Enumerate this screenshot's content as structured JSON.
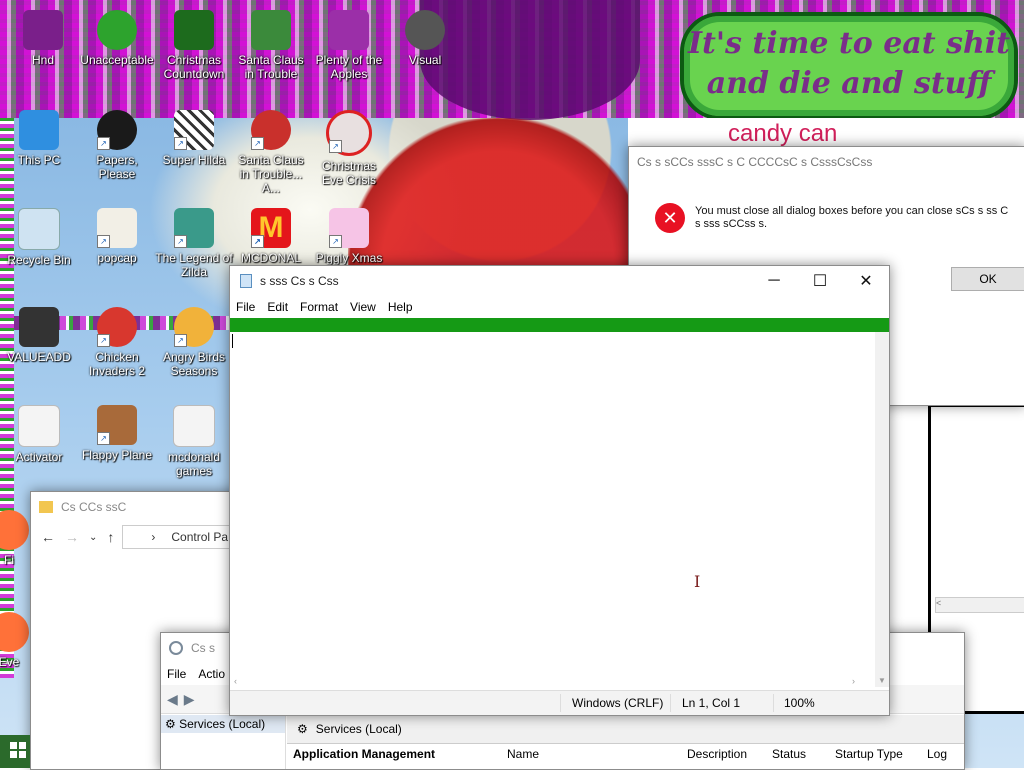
{
  "desktop": {
    "banner_text": "It's time to eat shit and die and stuff",
    "icons_top": [
      {
        "label": "Hnd"
      },
      {
        "label": "Unacceptable"
      },
      {
        "label": "Christmas Countdown"
      },
      {
        "label": "Santa Claus in Trouble"
      },
      {
        "label": "Plenty of the Apples"
      },
      {
        "label": "Visual"
      }
    ],
    "icons": [
      {
        "label": "This PC",
        "icon": "this-pc-icon"
      },
      {
        "label": "Papers, Please",
        "icon": "papers-please-icon"
      },
      {
        "label": "Super Hilda",
        "icon": "super-hilda-icon"
      },
      {
        "label": "Santa Claus in Trouble... A...",
        "icon": "santa-icon"
      },
      {
        "label": "Christmas Eve Crisis",
        "icon": "christmas-eve-icon"
      },
      {
        "label": "Recycle Bin",
        "icon": "recycle-bin-icon"
      },
      {
        "label": "popcap",
        "icon": "popcap-icon"
      },
      {
        "label": "The Legend of Zilda",
        "icon": "zilda-icon"
      },
      {
        "label": "MCDONAL",
        "icon": "mcdonalds-icon"
      },
      {
        "label": "Piggly Xmas",
        "icon": "piggly-icon"
      },
      {
        "label": "VALUEADD",
        "icon": "valueadd-icon"
      },
      {
        "label": "Chicken Invaders 2",
        "icon": "chicken-invaders-icon"
      },
      {
        "label": "Angry Birds Seasons",
        "icon": "angry-birds-icon"
      },
      {
        "label": "Activator",
        "icon": "activator-icon"
      },
      {
        "label": "Flappy Plane",
        "icon": "flappy-plane-icon"
      },
      {
        "label": "mcdonald games",
        "icon": "mcdonald-games-icon"
      },
      {
        "label": "Fi",
        "icon": "firefox-icon"
      },
      {
        "label": "Eve",
        "icon": "eve-icon"
      }
    ],
    "candy_text": "candy can"
  },
  "dialog": {
    "title": "Cs  s  sCCs sssC    s C CCCCsC s CsssCsCss",
    "message": "You must close all dialog boxes before you can close sCs s ss C  s sss sCCss   s.",
    "ok_label": "OK"
  },
  "notepad": {
    "title": "s sss   Cs  s  Css",
    "menu": [
      "File",
      "Edit",
      "Format",
      "View",
      "Help"
    ],
    "status": {
      "line_ending": "Windows (CRLF)",
      "position": "Ln 1, Col 1",
      "zoom": "100%"
    }
  },
  "control_panel": {
    "title": "Cs CCs ssC",
    "address": "Control Pa"
  },
  "services": {
    "title": "Cs  s",
    "menu": [
      "File",
      "Actio"
    ],
    "tree_item": "Services (Local)",
    "header_title": "Services (Local)",
    "left_heading": "Application Management",
    "columns": [
      "Name",
      "Description",
      "Status",
      "Startup Type",
      "Log"
    ]
  }
}
